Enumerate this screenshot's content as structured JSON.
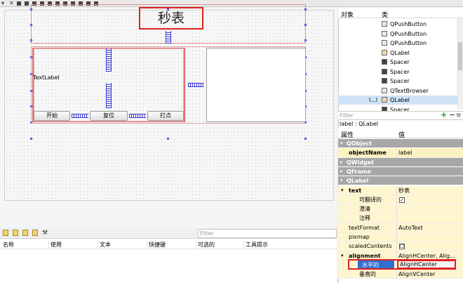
{
  "form": {
    "title": "秒表",
    "text_label": "TextLabel",
    "buttons": [
      "开始",
      "复位",
      "打点"
    ]
  },
  "action_editor": {
    "filter_placeholder": "Filter",
    "columns": [
      "名称",
      "使用",
      "文本",
      "快捷键",
      "可选的",
      "工具提示"
    ]
  },
  "object_inspector": {
    "columns": [
      "对象",
      "类"
    ],
    "rows": [
      {
        "object": "",
        "class": "QPushButton"
      },
      {
        "object": "",
        "class": "QPushButton"
      },
      {
        "object": "",
        "class": "QPushButton"
      },
      {
        "object": "",
        "class": "QLabel"
      },
      {
        "object": "",
        "class": "Spacer"
      },
      {
        "object": "",
        "class": "Spacer"
      },
      {
        "object": "",
        "class": "Spacer"
      },
      {
        "object": "",
        "class": "QTextBrowser"
      },
      {
        "object": "l...l",
        "class": "QLabel"
      },
      {
        "object": "",
        "class": "Spacer"
      }
    ]
  },
  "property_editor": {
    "filter_placeholder": "Filter",
    "object_caption": "label : QLabel",
    "columns": [
      "属性",
      "值"
    ],
    "rows": [
      {
        "kind": "cat",
        "name": "QObject",
        "value": ""
      },
      {
        "kind": "obj",
        "name": "objectName",
        "value": "label"
      },
      {
        "kind": "cat",
        "name": "QWidget",
        "value": ""
      },
      {
        "kind": "cat",
        "name": "QFrame",
        "value": ""
      },
      {
        "kind": "cat",
        "name": "QLabel",
        "value": ""
      },
      {
        "kind": "yellow",
        "name": "text",
        "value": "秒表"
      },
      {
        "kind": "sub",
        "name": "可翻译的",
        "value": "✓"
      },
      {
        "kind": "sub",
        "name": "澄清",
        "value": ""
      },
      {
        "kind": "sub",
        "name": "注释",
        "value": ""
      },
      {
        "kind": "yellow",
        "name": "textFormat",
        "value": "AutoText"
      },
      {
        "kind": "yellow",
        "name": "pixmap",
        "value": ""
      },
      {
        "kind": "yellow",
        "name": "scaledContents",
        "value": "☐"
      },
      {
        "kind": "yellow",
        "name": "alignment",
        "value": "AlignHCenter, Alig..."
      },
      {
        "kind": "sel",
        "name": "水平的",
        "value": "AlignHCenter"
      },
      {
        "kind": "sub",
        "name": "垂直的",
        "value": "AlignVCenter"
      }
    ]
  },
  "colors": {
    "highlight_red": "#e02020",
    "category_gray": "#a7a7a7",
    "selection_blue": "#2f6fd0"
  }
}
